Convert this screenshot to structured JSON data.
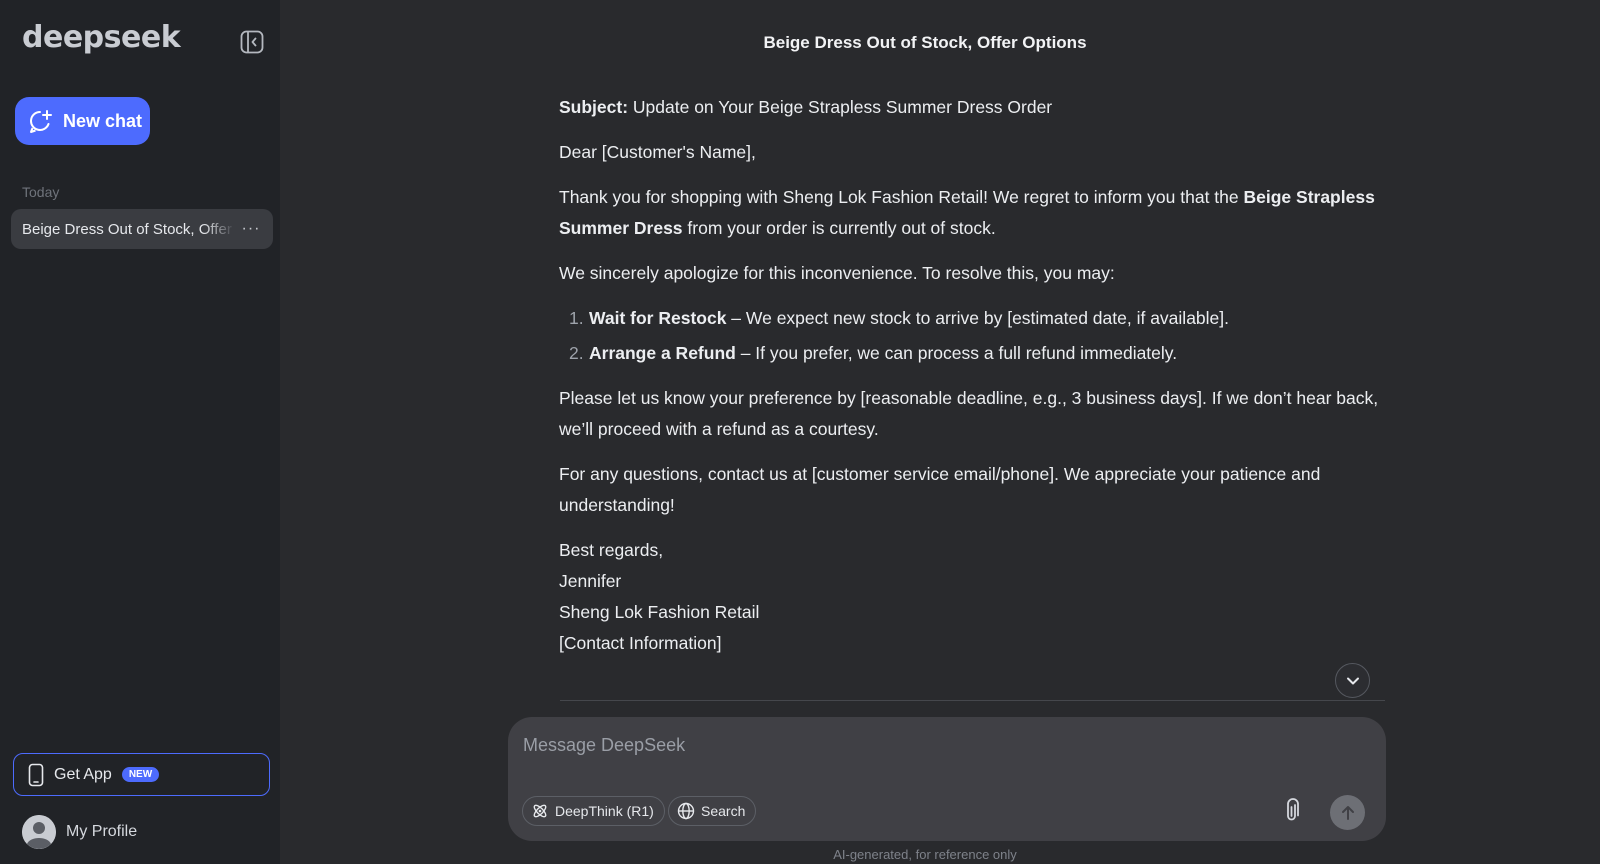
{
  "sidebar": {
    "logo": "deepseek",
    "new_chat_label": "New chat",
    "section_today": "Today",
    "history": [
      {
        "title": "Beige Dress Out of Stock, Offer Options",
        "more": "···"
      }
    ],
    "get_app_label": "Get App",
    "get_app_badge": "NEW",
    "profile_label": "My Profile"
  },
  "main": {
    "chat_title": "Beige Dress Out of Stock, Offer Options",
    "message": {
      "subject_label": "Subject:",
      "subject_text": " Update on Your Beige Strapless Summer Dress Order",
      "greeting": "Dear [Customer's Name],",
      "p1_a": "Thank you for shopping with Sheng Lok Fashion Retail! We regret to inform you that the ",
      "p1_b": "Beige Strapless Summer Dress",
      "p1_c": " from your order is currently out of stock.",
      "p2": "We sincerely apologize for this inconvenience. To resolve this, you may:",
      "options": [
        {
          "num": "1.",
          "title": "Wait for Restock",
          "text": " – We expect new stock to arrive by [estimated date, if available]."
        },
        {
          "num": "2.",
          "title": "Arrange a Refund",
          "text": " – If you prefer, we can process a full refund immediately."
        }
      ],
      "p3": "Please let us know your preference by [reasonable deadline, e.g., 3 business days]. If we don’t hear back, we’ll proceed with a refund as a courtesy.",
      "p4": "For any questions, contact us at [customer service email/phone]. We appreciate your patience and understanding!",
      "signoff": "Best regards,",
      "sign_name": "Jennifer",
      "sign_company": "Sheng Lok Fashion Retail",
      "sign_contact": "[Contact Information]"
    },
    "composer": {
      "placeholder": "Message DeepSeek",
      "deepthink_label": "DeepThink (R1)",
      "search_label": "Search"
    },
    "disclaimer": "AI-generated, for reference only"
  },
  "colors": {
    "accent": "#4d6bfe",
    "sidebar_bg": "#212327",
    "main_bg": "#292a2d",
    "composer_bg": "#404045"
  },
  "icons": [
    "collapse-sidebar-icon",
    "new-chat-icon",
    "more-icon",
    "phone-icon",
    "avatar-icon",
    "chevron-down-icon",
    "deepthink-icon",
    "globe-icon",
    "paperclip-icon",
    "arrow-up-icon"
  ]
}
